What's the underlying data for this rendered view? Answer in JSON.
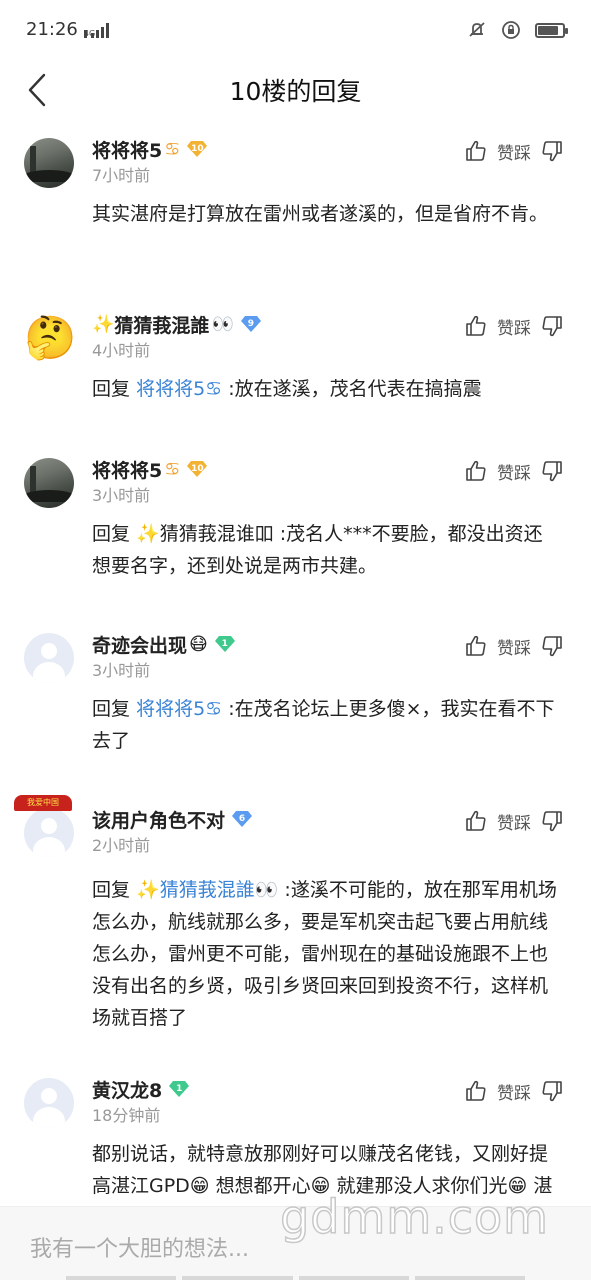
{
  "status_bar": {
    "time": "21:26",
    "network": "4G",
    "battery_level": 0.85
  },
  "nav": {
    "title": "10楼的回复"
  },
  "comments": [
    {
      "username": "将将将5",
      "user_emoji": "♋",
      "level": "10",
      "level_color": "#f2b233",
      "time": "7小时前",
      "like_label": "赞踩",
      "content": "其实湛府是打算放在雷州或者遂溪的，但是省府不肯。"
    },
    {
      "username_prefix": "✨",
      "username": "猜猜莪混誰",
      "user_emoji": "👀",
      "level": "9",
      "level_color": "#5b9cf0",
      "time": "4小时前",
      "like_label": "赞踩",
      "reply_word": "回复",
      "mention": "将将将5♋",
      "content": " :放在遂溪，茂名代表在搞搞震"
    },
    {
      "username": "将将将5",
      "user_emoji": "♋",
      "level": "10",
      "level_color": "#f2b233",
      "time": "3小时前",
      "like_label": "赞踩",
      "reply_word": "回复",
      "mention": "✨猜猜莪混谁吅",
      "content": " :茂名人***不要脸，都没出资还想要名字，还到处说是两市共建。"
    },
    {
      "username": "奇迹会出现",
      "user_emoji": "😷",
      "level": "1",
      "level_color": "#3fc98c",
      "time": "3小时前",
      "like_label": "赞踩",
      "reply_word": "回复",
      "mention": "将将将5♋",
      "content": " :在茂名论坛上更多傻×，我实在看不下去了"
    },
    {
      "username": "该用户角色不对",
      "level": "6",
      "level_color": "#5b9cf0",
      "avatar_flag": "我爱中国",
      "time": "2小时前",
      "like_label": "赞踩",
      "reply_word": "回复",
      "mention": "✨猜猜莪混誰👀",
      "content": " :遂溪不可能的，放在那军用机场怎么办，航线就那么多，要是军机突击起飞要占用航线怎么办，雷州更不可能，雷州现在的基础设施跟不上也没有出名的乡贤，吸引乡贤回来回到投资不行，这样机场就百搭了"
    },
    {
      "username": "黄汉龙8",
      "level": "1",
      "level_color": "#3fc98c",
      "time": "18分钟前",
      "like_label": "赞踩",
      "content": "都别说话，就特意放那刚好可以赚茂名佬钱，又刚好提高湛江GPD😁 想想都开心😁 就建那没人求你们光😁 湛江境内想建哪就建哪😁"
    }
  ],
  "input": {
    "placeholder": "我有一个大胆的想法..."
  },
  "watermark": "gdmm.com",
  "icons": {
    "back": "chevron-left-icon",
    "like": "thumbs-up-icon",
    "dislike": "thumbs-down-icon",
    "level": "diamond-badge-icon"
  }
}
